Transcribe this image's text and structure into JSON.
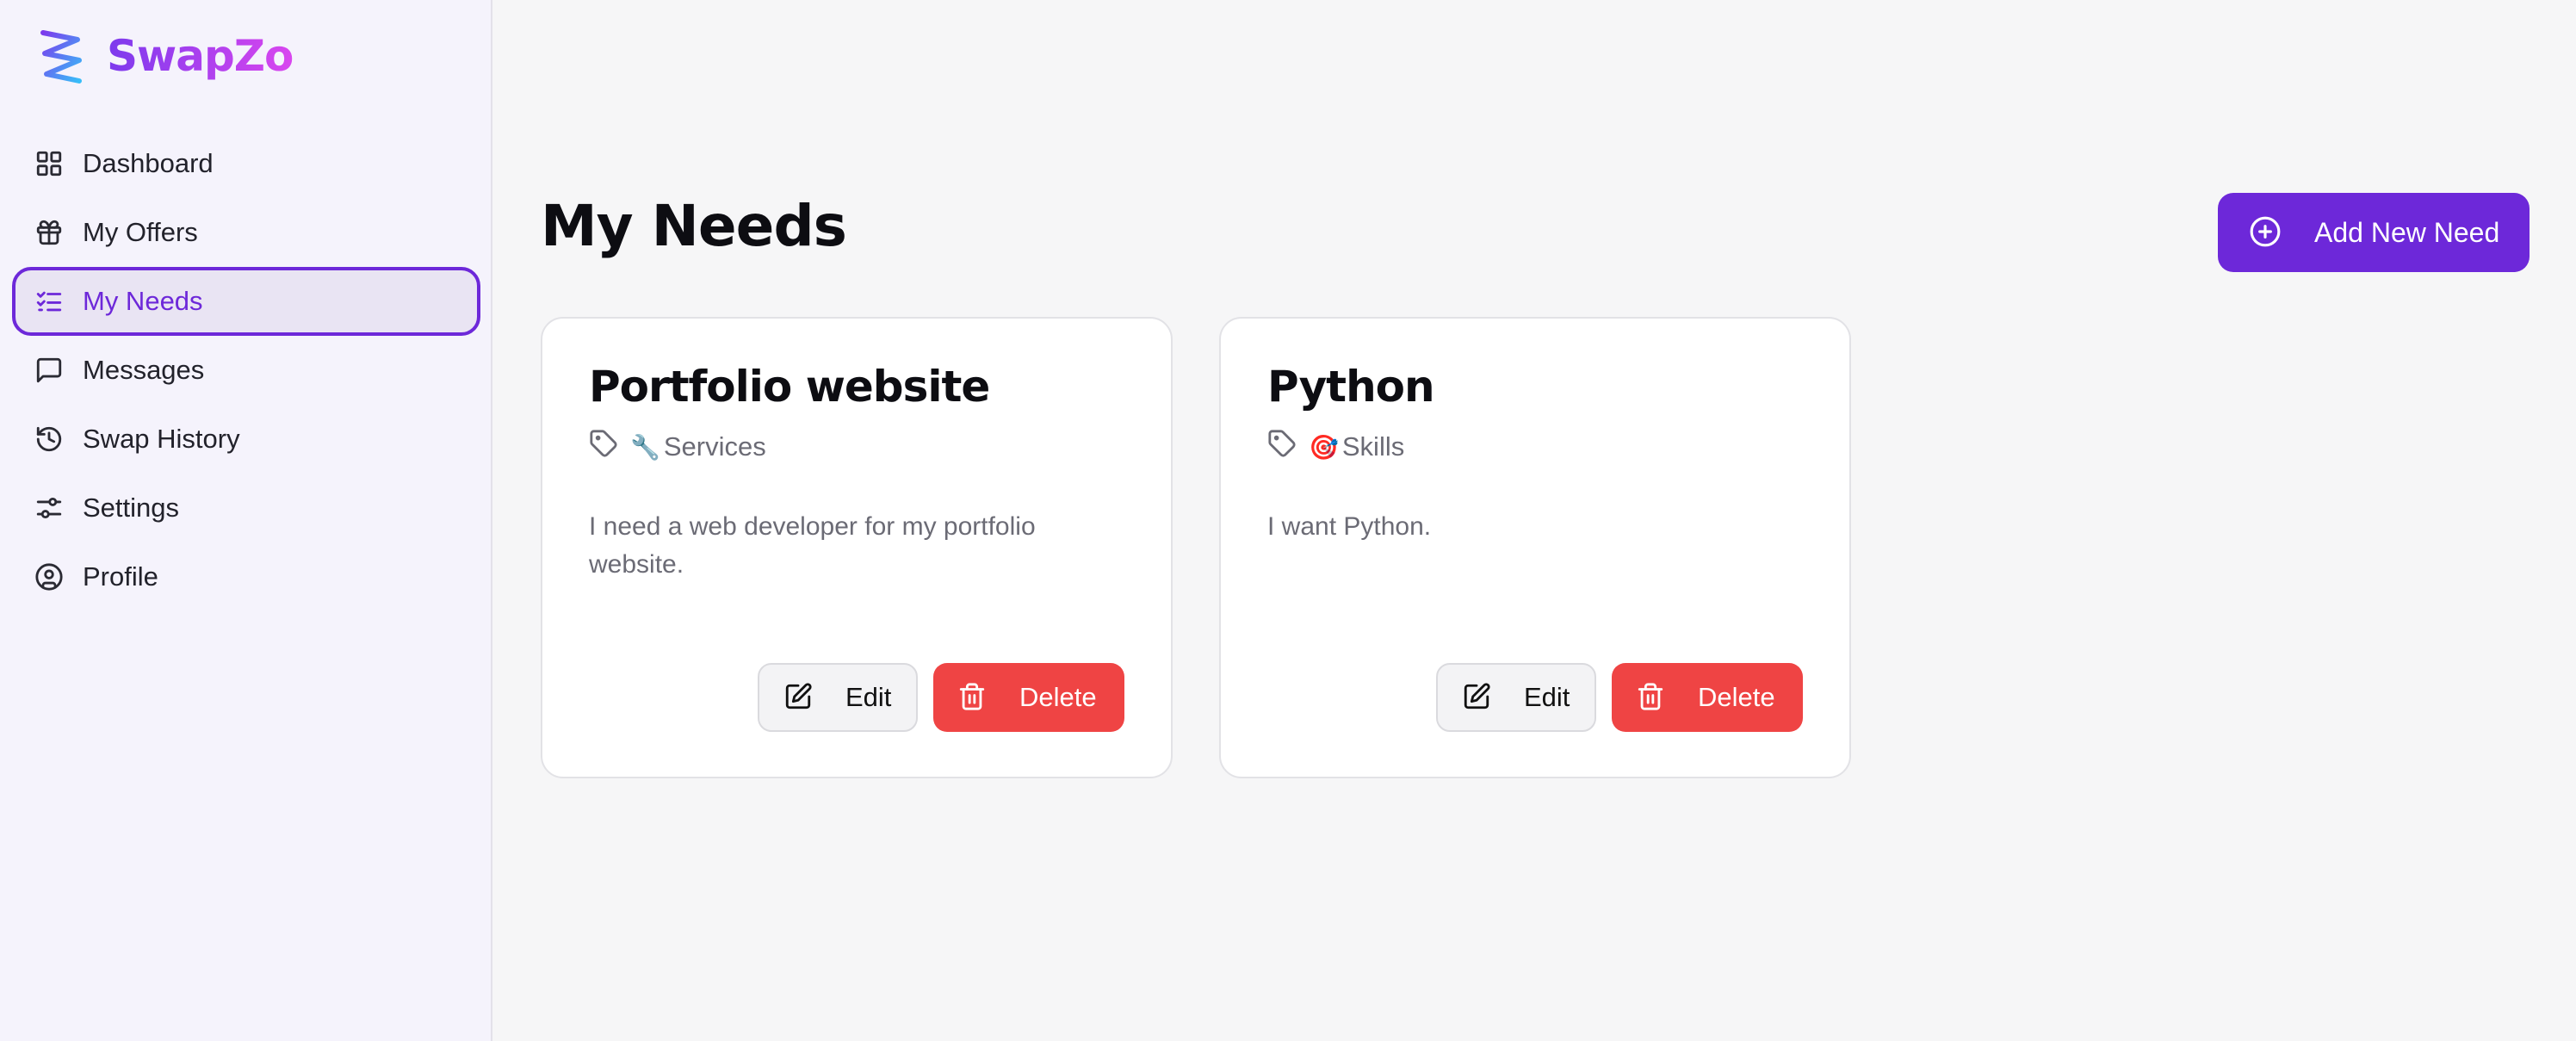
{
  "brand": {
    "name": "SwapZo",
    "logo_icon": "swapzo-zigzag-logo"
  },
  "sidebar": {
    "items": [
      {
        "label": "Dashboard",
        "icon": "grid-icon",
        "active": false
      },
      {
        "label": "My Offers",
        "icon": "gift-icon",
        "active": false
      },
      {
        "label": "My Needs",
        "icon": "list-check-icon",
        "active": true
      },
      {
        "label": "Messages",
        "icon": "message-square-icon",
        "active": false
      },
      {
        "label": "Swap History",
        "icon": "history-icon",
        "active": false
      },
      {
        "label": "Settings",
        "icon": "sliders-icon",
        "active": false
      },
      {
        "label": "Profile",
        "icon": "user-circle-icon",
        "active": false
      }
    ]
  },
  "main": {
    "title": "My Needs",
    "add_button": {
      "label": "Add New Need",
      "icon": "plus-circle-icon"
    },
    "cards": [
      {
        "title": "Portfolio website",
        "category_emoji": "🔧",
        "category": "Services",
        "description": "I need a web developer for my portfolio website.",
        "edit_label": "Edit",
        "delete_label": "Delete"
      },
      {
        "title": "Python",
        "category_emoji": "🎯",
        "category": "Skills",
        "description": "I want Python.",
        "edit_label": "Edit",
        "delete_label": "Delete"
      }
    ]
  },
  "colors": {
    "accent": "#6d28d9",
    "danger": "#ef4444",
    "sidebar_bg": "#f5f3fc",
    "page_bg": "#f6f6f7"
  }
}
